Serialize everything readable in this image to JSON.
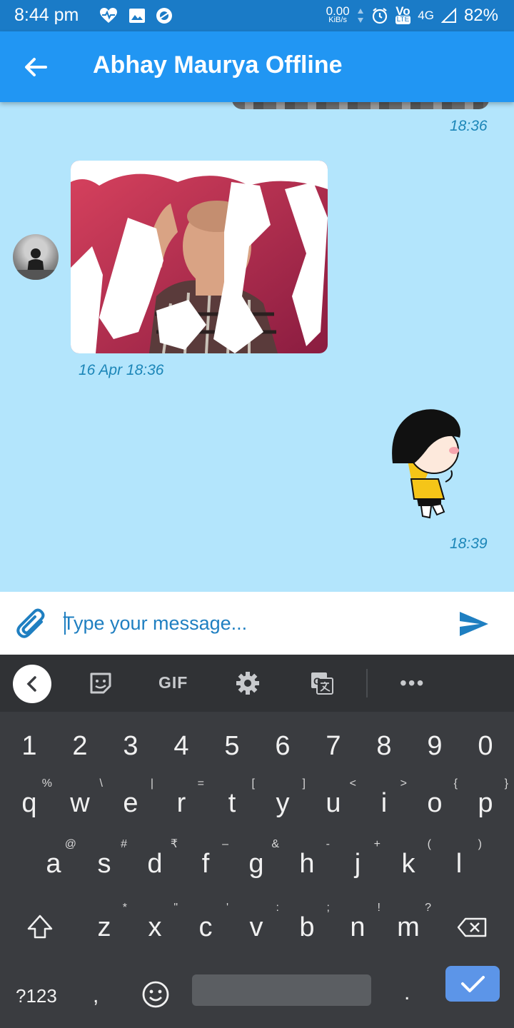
{
  "status_bar": {
    "time": "8:44 pm",
    "speed_value": "0.00",
    "speed_unit": "KiB/s",
    "volte": "Vo",
    "lte": "LTE",
    "network": "4G",
    "battery": "82%"
  },
  "app_bar": {
    "title": "Abhay Maurya Offline"
  },
  "messages": {
    "prev_time": "18:36",
    "photo_time": "16 Apr 18:36",
    "sticker_time": "18:39"
  },
  "composer": {
    "placeholder": "Type your message..."
  },
  "keyboard": {
    "toolbar_gif": "GIF",
    "number_row": [
      "1",
      "2",
      "3",
      "4",
      "5",
      "6",
      "7",
      "8",
      "9",
      "0"
    ],
    "row1": [
      {
        "k": "q",
        "h": "%"
      },
      {
        "k": "w",
        "h": "\\"
      },
      {
        "k": "e",
        "h": "|"
      },
      {
        "k": "r",
        "h": "="
      },
      {
        "k": "t",
        "h": "["
      },
      {
        "k": "y",
        "h": "]"
      },
      {
        "k": "u",
        "h": "<"
      },
      {
        "k": "i",
        "h": ">"
      },
      {
        "k": "o",
        "h": "{"
      },
      {
        "k": "p",
        "h": "}"
      }
    ],
    "row2": [
      {
        "k": "a",
        "h": "@"
      },
      {
        "k": "s",
        "h": "#"
      },
      {
        "k": "d",
        "h": "₹"
      },
      {
        "k": "f",
        "h": "–"
      },
      {
        "k": "g",
        "h": "&"
      },
      {
        "k": "h",
        "h": "-"
      },
      {
        "k": "j",
        "h": "+"
      },
      {
        "k": "k",
        "h": "("
      },
      {
        "k": "l",
        "h": ")"
      }
    ],
    "row3": [
      {
        "k": "z",
        "h": "*"
      },
      {
        "k": "x",
        "h": "\""
      },
      {
        "k": "c",
        "h": "'"
      },
      {
        "k": "v",
        "h": ":"
      },
      {
        "k": "b",
        "h": ";"
      },
      {
        "k": "n",
        "h": "!"
      },
      {
        "k": "m",
        "h": "?"
      }
    ],
    "sym_label": "?123",
    "comma": ",",
    "period": "."
  },
  "colors": {
    "status_bar": "#1a7bc7",
    "app_bar": "#2196f3",
    "chat_bg": "#b3e5fc",
    "keyboard_bg": "#3a3c40",
    "accent": "#1f7fc1"
  }
}
